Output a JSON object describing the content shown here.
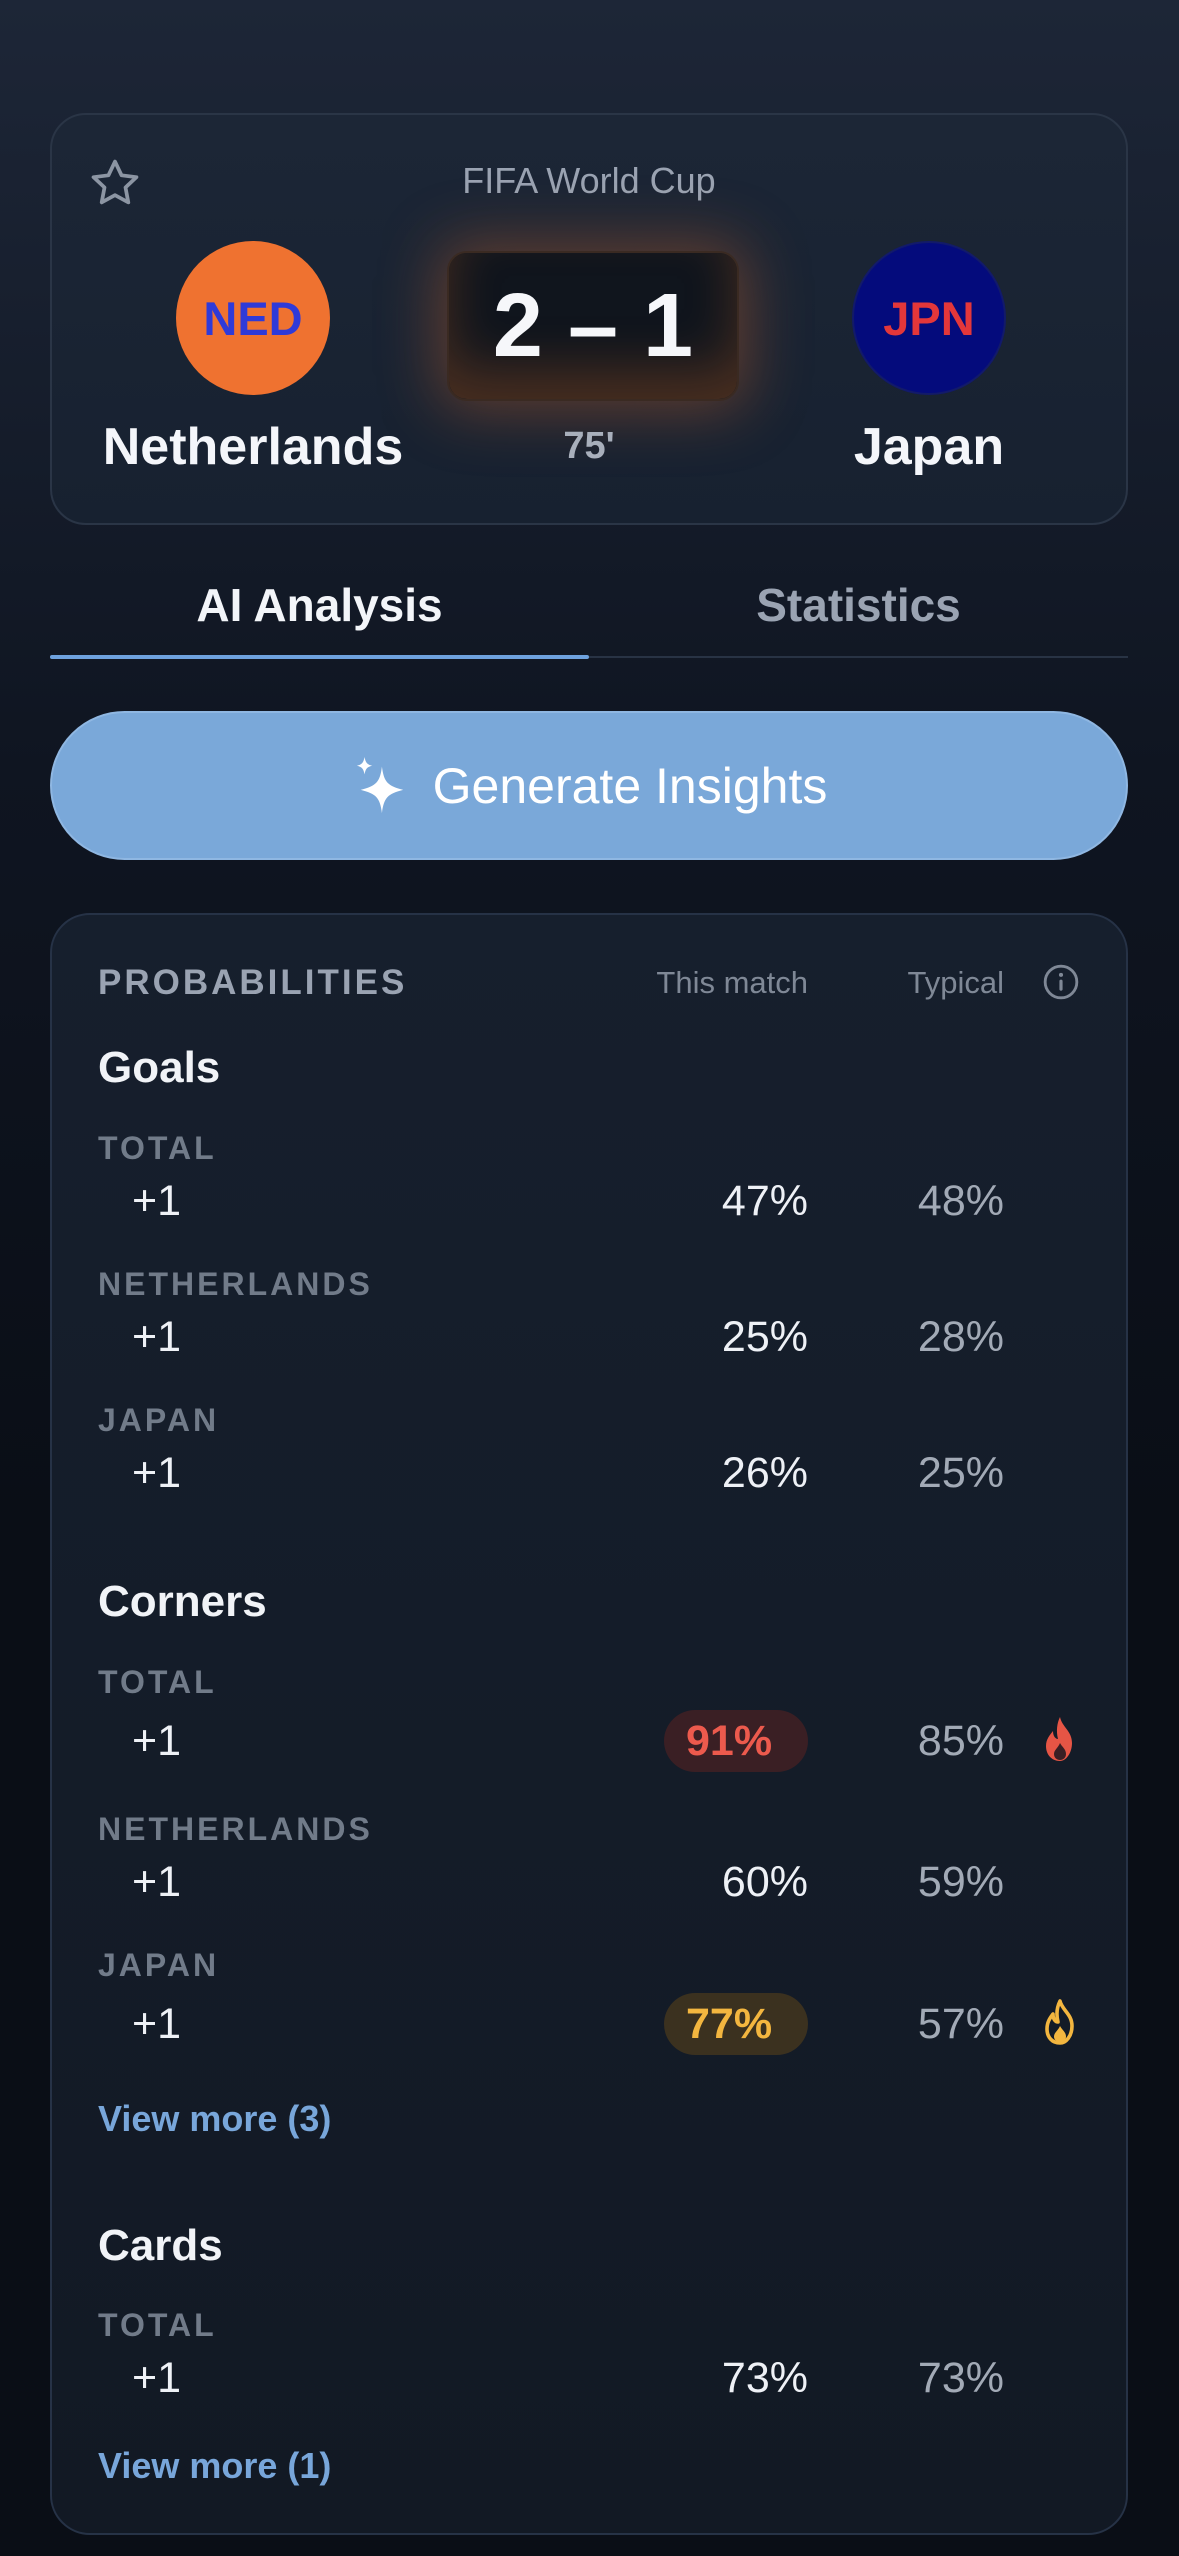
{
  "match": {
    "competition": "FIFA World Cup",
    "home": {
      "code": "NED",
      "name": "Netherlands",
      "color": "#ef7230"
    },
    "away": {
      "code": "JPN",
      "name": "Japan",
      "color": "#040b7c"
    },
    "score": "2 – 1",
    "minute": "75'"
  },
  "tabs": [
    {
      "label": "AI Analysis",
      "active": true
    },
    {
      "label": "Statistics",
      "active": false
    }
  ],
  "generate_button": {
    "label": "Generate Insights",
    "color": "#7aa8d9"
  },
  "probabilities": {
    "header": "PROBABILITIES",
    "col_this": "This match",
    "col_typical": "Typical",
    "groups": [
      {
        "title": "Goals",
        "rows": [
          {
            "label": "TOTAL",
            "line": "+1",
            "this": "47%",
            "typical": "48%"
          },
          {
            "label": "NETHERLANDS",
            "line": "+1",
            "this": "25%",
            "typical": "28%"
          },
          {
            "label": "JAPAN",
            "line": "+1",
            "this": "26%",
            "typical": "25%"
          }
        ]
      },
      {
        "title": "Corners",
        "rows": [
          {
            "label": "TOTAL",
            "line": "+1",
            "this": "91%",
            "typical": "85%",
            "highlight": "hot-red"
          },
          {
            "label": "NETHERLANDS",
            "line": "+1",
            "this": "60%",
            "typical": "59%"
          },
          {
            "label": "JAPAN",
            "line": "+1",
            "this": "77%",
            "typical": "57%",
            "highlight": "warm-yellow"
          }
        ],
        "view_more": "View more (3)"
      },
      {
        "title": "Cards",
        "rows": [
          {
            "label": "TOTAL",
            "line": "+1",
            "this": "73%",
            "typical": "73%"
          }
        ],
        "view_more": "View more (1)"
      }
    ]
  }
}
